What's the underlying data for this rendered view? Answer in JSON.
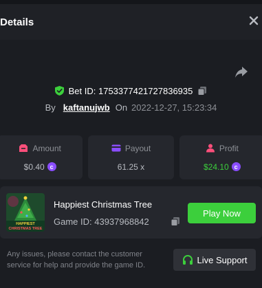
{
  "header": {
    "title": "Details",
    "close_icon": "close-icon"
  },
  "bet": {
    "id_label": "Bet ID: 1753377421727836935",
    "by_label": "By",
    "username": "kaftanujwb",
    "on_label": "On",
    "date": "2022-12-27, 15:23:34"
  },
  "stats": {
    "amount": {
      "label": "Amount",
      "value": "$0.40",
      "icon": "amount-icon",
      "color": "#ff4f7b"
    },
    "payout": {
      "label": "Payout",
      "value": "61.25 x",
      "icon": "payout-icon",
      "color": "#8a4dff"
    },
    "profit": {
      "label": "Profit",
      "value": "$24.10",
      "icon": "profit-icon",
      "color": "#3ccf3c"
    }
  },
  "game": {
    "name": "Happiest Christmas Tree",
    "id_label": "Game ID: 43937968842",
    "thumb_text_1": "HAPPIEST",
    "thumb_text_2": "CHRISTMAS TREE",
    "play_label": "Play Now"
  },
  "support": {
    "note": "Any issues, please contact the customer service for help and provide the game ID.",
    "live_label": "Live Support"
  },
  "colors": {
    "accent_green": "#3ccf3c",
    "coin": "#8a4dff",
    "background": "#1b1d22"
  }
}
